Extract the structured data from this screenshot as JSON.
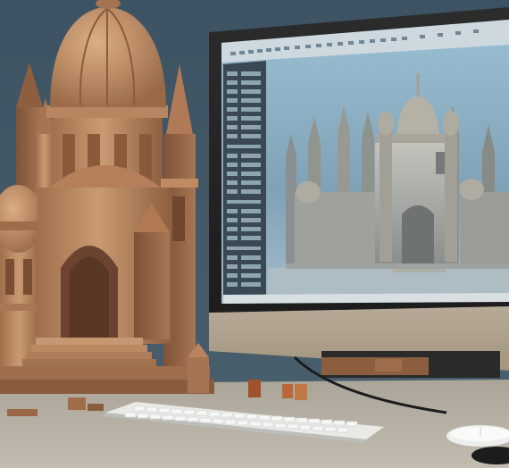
{
  "scene": {
    "background_color": "#3f5565",
    "desk_color": "#b9b2a6",
    "wood_color": "#b9845e",
    "screen_tint": "#8fb3c8"
  },
  "monitor": {
    "app_panel_rows": 28,
    "toolbar_icons": 22
  },
  "icons": [
    "castle-model",
    "monitor",
    "keyboard",
    "mouse"
  ]
}
